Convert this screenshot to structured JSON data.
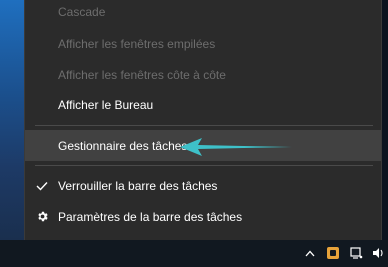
{
  "menu": {
    "items": [
      {
        "label": "Cascade",
        "state": "disabled"
      },
      {
        "label": "Afficher les fenêtres empilées",
        "state": "disabled"
      },
      {
        "label": "Afficher les fenêtres côte à côte",
        "state": "disabled"
      },
      {
        "label": "Afficher le Bureau",
        "state": "enabled"
      },
      {
        "label": "Gestionnaire des tâches",
        "state": "highlighted"
      },
      {
        "label": "Verrouiller la barre des tâches",
        "state": "checked"
      },
      {
        "label": "Paramètres de la barre des tâches",
        "state": "enabled",
        "icon": "gear-icon"
      }
    ]
  },
  "annotation": {
    "arrow_color": "#3ec1c9",
    "points_to": "Gestionnaire des tâches"
  },
  "taskbar": {
    "tray_icons": [
      "chevron-up-icon",
      "app-tray-icon",
      "display-icon",
      "volume-icon"
    ]
  },
  "colors": {
    "menu_bg": "#2b2b2b",
    "highlight_bg": "#414141",
    "disabled_text": "#6d6d6d",
    "text": "#ffffff",
    "accent_arrow": "#3ec1c9"
  }
}
